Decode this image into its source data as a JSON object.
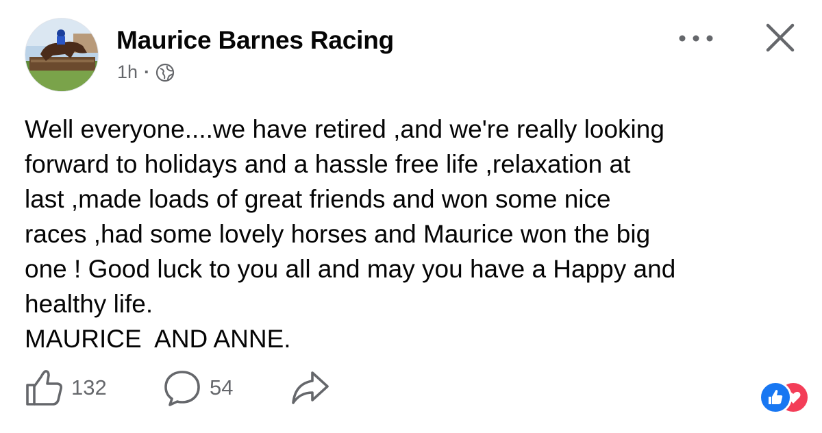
{
  "post": {
    "author": "Maurice Barnes Racing",
    "time": "1h",
    "separator": "·",
    "privacy_icon": "globe-icon",
    "text_lines": [
      "Well everyone....we have retired ,and we're really looking",
      "forward to holidays and a hassle free life ,relaxation at",
      "last ,made loads of great friends and won some nice",
      "races ,had some lovely horses and Maurice won the big",
      "one ! Good luck to you all and may you have a Happy and",
      "healthy life.",
      "MAURICE  AND ANNE."
    ]
  },
  "header_actions": {
    "more_icon": "more-options-icon",
    "close_icon": "close-icon"
  },
  "actions": {
    "like_count": "132",
    "comment_count": "54",
    "like_icon": "thumbs-up-icon",
    "comment_icon": "comment-bubble-icon",
    "share_icon": "share-arrow-icon"
  },
  "reactions": [
    "like",
    "love"
  ],
  "colors": {
    "text": "#050505",
    "secondary_text": "#65676b",
    "like_blue": "#1877f2",
    "love_red": "#f33e58"
  }
}
